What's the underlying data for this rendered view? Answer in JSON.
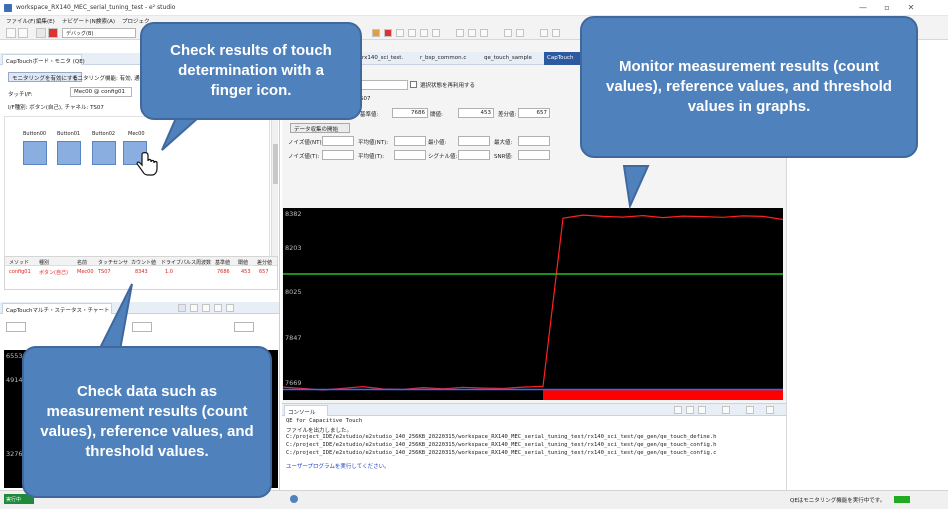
{
  "window": {
    "title": "workspace_RX140_MEC_serial_tuning_test - e² studio",
    "controls": {
      "minimize": "—",
      "maximize": "▫",
      "close": "✕"
    }
  },
  "menu": [
    "ファイル(F)",
    "編集(E)",
    "ナビゲート(N)",
    "検索(A)",
    "プロジェク"
  ],
  "toolbar": {
    "debug_label": "デバッグ(B)"
  },
  "left_view": {
    "tab_label": "CapTouchボード・モニタ (QE)",
    "enable_button": "モニタリングを有効にする",
    "monitor_status": "モニタリング機能: 有効, 通信",
    "touch_label": "タッチI/F:",
    "touch_value": "Mec00 @ config01",
    "interface_info": "I/F種別: ボタン(自己), チャネル: TS07",
    "buttons": [
      "Button00",
      "Button01",
      "Button02",
      "Mec00"
    ],
    "table": {
      "headers": [
        "メソッド",
        "種別",
        "名前",
        "タッチセンサ",
        "カウント値",
        "ドライブパルス周波数",
        "基準値",
        "閾値",
        "差分値"
      ],
      "row": [
        "config01",
        "ボタン(自己)",
        "Mec00",
        "TS07",
        "8343",
        "1.0",
        "7686",
        "453",
        "657"
      ]
    }
  },
  "left_lower": {
    "tab_label": "CapTouchマルチ・ステータス・チャート",
    "axis_values": [
      "6553",
      "4914",
      "3276"
    ]
  },
  "editor_tabs": [
    "rx140_sci_test.",
    "r_bsp_common.c",
    "qe_touch_sample",
    "CapTouch"
  ],
  "params": {
    "save_checkbox_label": "選択状態を再利用する",
    "channel_label": "S07",
    "baseline_label": "基準値:",
    "baseline_value": "7686",
    "threshold_label": "閾値:",
    "threshold_value": "453",
    "difference_label": "差分値:",
    "difference_value": "657",
    "start_record_button": "データ収集の開始",
    "noise_nt_label": "ノイズ値(NT):",
    "avg_nt_label": "平均値(NT):",
    "min_label": "最小値:",
    "max_label": "最大値:",
    "noise_t_label": "ノイズ値(T):",
    "avg_t_label": "平均値(T):",
    "signal_label": "シグナル値:",
    "snr_label": "SNR値:"
  },
  "chart_data": {
    "type": "line",
    "ylabels": [
      "8382",
      "8203",
      "8025",
      "7847",
      "7669"
    ],
    "x": [
      0,
      4,
      8,
      12,
      16,
      20,
      24,
      28,
      32,
      36,
      40,
      44,
      48,
      52,
      56,
      60,
      64,
      68,
      72,
      76,
      80,
      84,
      88,
      92,
      96,
      100
    ],
    "series": [
      {
        "color": "#ff2020",
        "values": [
          7672,
          7666,
          7660,
          7667,
          7674,
          7664,
          7662,
          7670,
          7665,
          7671,
          7668,
          7666,
          7672,
          7675,
          8370,
          8382,
          8377,
          8374,
          8380,
          8372,
          8378,
          8376,
          8373,
          8379,
          8377,
          8364
        ]
      },
      {
        "color": "#22c022",
        "values": [
          8139,
          8139,
          8139,
          8139,
          8139,
          8139,
          8139,
          8139,
          8139,
          8139,
          8139,
          8139,
          8139,
          8139,
          8139,
          8139,
          8139,
          8139,
          8139,
          8139,
          8139,
          8139,
          8139,
          8139,
          8139,
          8139
        ]
      },
      {
        "color": "#2e6fff",
        "values": [
          7662,
          7662,
          7662,
          7662,
          7662,
          7662,
          7662,
          7662,
          7662,
          7662,
          7662,
          7662,
          7662,
          7662,
          7662,
          7662,
          7662,
          7662,
          7662,
          7662,
          7662,
          7662,
          7662,
          7662,
          7662,
          7662
        ]
      }
    ],
    "touch_state": {
      "off_until": 52,
      "color": "#ff0000"
    },
    "ylim": [
      7660,
      8395
    ]
  },
  "console": {
    "tab_label": "コンソール",
    "title": "QE for Capacitive Touch",
    "lines": [
      "ファイルを出力しました。",
      "C:/project_IDE/e2studio/e2studio_140_256KB_20220315/workspace_RX140_MEC_serial_tuning_test/rx140_sci_test/qe_gen/qe_touch_define.h",
      "C:/project_IDE/e2studio/e2studio_140_256KB_20220315/workspace_RX140_MEC_serial_tuning_test/rx140_sci_test/qe_gen/qe_touch_config.h",
      "C:/project_IDE/e2studio/e2studio_140_256KB_20220315/workspace_RX140_MEC_serial_tuning_test/rx140_sci_test/qe_gen/qe_touch_config.c"
    ],
    "user_prompt": "ユーザープログラムを実行してください。"
  },
  "status": {
    "left_badge": "実行中",
    "right_text": "QEはモニタリング機能を実行中です。"
  },
  "callouts": {
    "finger": "Check results of touch determination with a finger icon.",
    "graph": "Monitor measurement results (count values), reference values, and threshold values in graphs.",
    "data": "Check data such as measurement results (count values), reference values, and threshold values."
  }
}
